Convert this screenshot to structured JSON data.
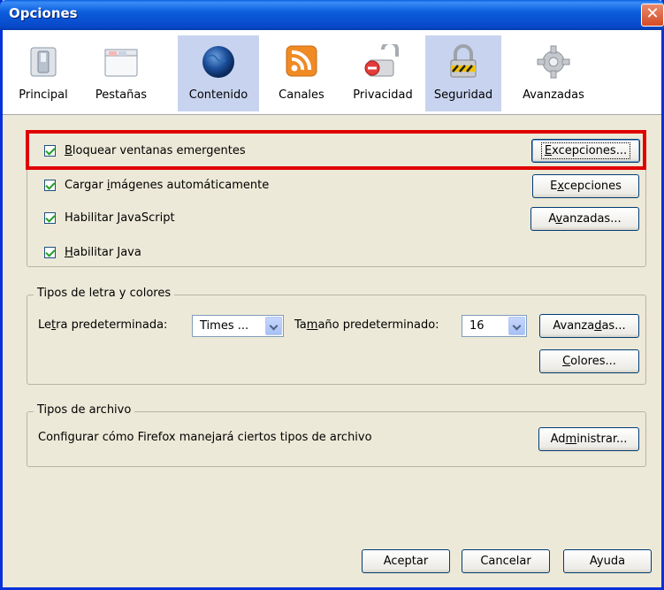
{
  "window": {
    "title": "Opciones"
  },
  "toolbar": {
    "items": [
      {
        "label": "Principal",
        "icon": "switch-icon",
        "selected": false
      },
      {
        "label": "Pestañas",
        "icon": "tabs-window-icon",
        "selected": false
      },
      {
        "label": "Contenido",
        "icon": "globe-icon",
        "selected": true
      },
      {
        "label": "Canales",
        "icon": "rss-feed-icon",
        "selected": false
      },
      {
        "label": "Privacidad",
        "icon": "privacy-lock-icon",
        "selected": false
      },
      {
        "label": "Seguridad",
        "icon": "padlock-icon",
        "selected": true
      },
      {
        "label": "Avanzadas",
        "icon": "gear-icon",
        "selected": false
      }
    ]
  },
  "content": {
    "checkboxes": [
      {
        "label_underline": "B",
        "label_rest": "loquear ventanas emergentes",
        "checked": true
      },
      {
        "label_pre": "Cargar ",
        "label_underline": "i",
        "label_rest": "mágenes automáticamente",
        "checked": true
      },
      {
        "label_pre": "Habilitar ",
        "label_underline": "J",
        "label_rest": "avaScript",
        "checked": true
      },
      {
        "label_underline": "H",
        "label_rest": "abilitar Java",
        "checked": true
      }
    ],
    "buttons": {
      "exceptions_popups": {
        "pre": "",
        "underline": "E",
        "rest": "xcepciones..."
      },
      "exceptions_images": {
        "pre": "E",
        "underline": "x",
        "rest": "cepciones"
      },
      "advanced_js": {
        "pre": "A",
        "underline": "v",
        "rest": "anzadas..."
      }
    }
  },
  "fonts": {
    "group_label": "Tipos de letra y colores",
    "default_font_label_pre": "Le",
    "default_font_label_underline": "t",
    "default_font_label_rest": "ra predeterminada:",
    "default_font_value": "Times ...",
    "size_label_pre": "Ta",
    "size_label_underline": "m",
    "size_label_rest": "año predeterminado:",
    "size_value": "16",
    "advanced_button": {
      "pre": "Avanza",
      "underline": "d",
      "rest": "as..."
    },
    "colors_button": {
      "pre": "",
      "underline": "C",
      "rest": "olores..."
    }
  },
  "filetypes": {
    "group_label": "Tipos de archivo",
    "description": "Configurar cómo Firefox manejará ciertos tipos de archivo",
    "manage_button": {
      "pre": "Ad",
      "underline": "m",
      "rest": "inistrar..."
    }
  },
  "footer": {
    "ok": "Aceptar",
    "cancel": "Cancelar",
    "help": "Ayuda"
  },
  "colors": {
    "titlebar": "#0b5ddd",
    "selected_tab": "#c8d4ef",
    "highlight": "#e00000",
    "dialog_bg": "#ece9d8"
  }
}
